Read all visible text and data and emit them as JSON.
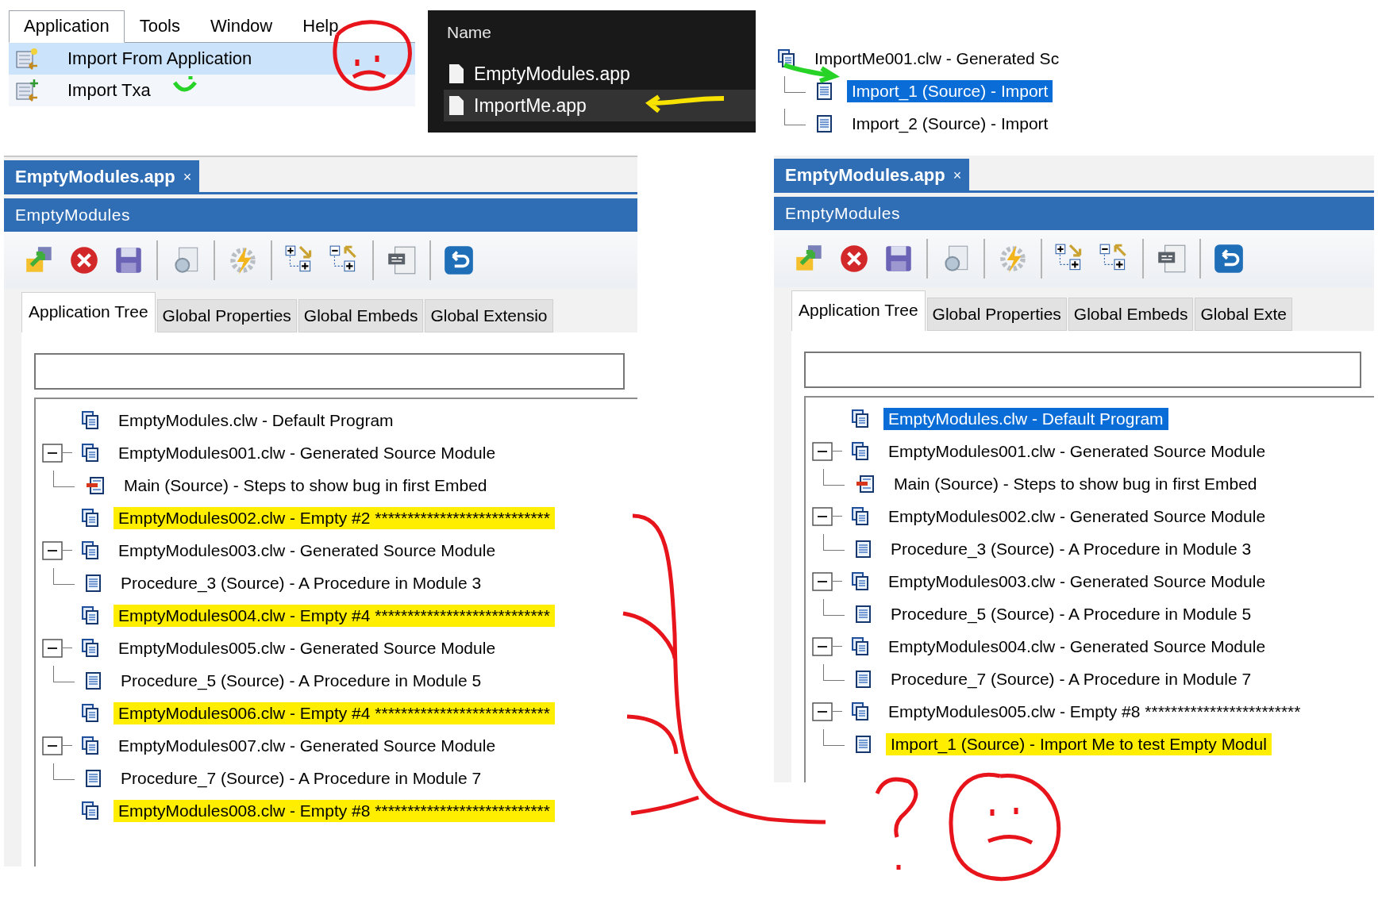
{
  "menu_panel": {
    "menubar": [
      {
        "label": "Application",
        "selected": true
      },
      {
        "label": "Tools",
        "selected": false
      },
      {
        "label": "Window",
        "selected": false
      },
      {
        "label": "Help",
        "selected": false
      }
    ],
    "items": [
      {
        "label": "Import From Application",
        "selected": true
      },
      {
        "label": "Import Txa",
        "selected": false
      }
    ]
  },
  "file_panel": {
    "column_header": "Name",
    "files": [
      {
        "name": "EmptyModules.app",
        "selected": false
      },
      {
        "name": "ImportMe.app",
        "selected": true
      }
    ]
  },
  "import_tree": {
    "rows": [
      {
        "text": "ImportMe001.clw - Generated Sc",
        "kind": "module",
        "selected": false,
        "children": [
          {
            "text": "Import_1 (Source) - Import",
            "kind": "source",
            "selected": true
          },
          {
            "text": "Import_2 (Source) - Import",
            "kind": "source",
            "selected": false
          }
        ]
      }
    ]
  },
  "panels": [
    {
      "doc_tab": "EmptyModules.app",
      "close": "×",
      "title": "EmptyModules",
      "tabs": [
        {
          "label": "Application Tree",
          "selected": true
        },
        {
          "label": "Global Properties",
          "selected": false
        },
        {
          "label": "Global Embeds",
          "selected": false
        },
        {
          "label": "Global Extensio",
          "selected": false
        }
      ],
      "tree": [
        {
          "text": "EmptyModules.clw - Default Program",
          "kind": "module",
          "selected": false,
          "highlighted": false
        },
        {
          "text": "EmptyModules001.clw - Generated Source Module",
          "kind": "module",
          "selected": false,
          "highlighted": false,
          "children": [
            {
              "text": "Main (Source) - Steps to show bug in first Embed",
              "kind": "main",
              "selected": false,
              "highlighted": false
            }
          ]
        },
        {
          "text": "EmptyModules002.clw - Empty #2 ***************************",
          "kind": "module",
          "selected": false,
          "highlighted": true
        },
        {
          "text": "EmptyModules003.clw - Generated Source Module",
          "kind": "module",
          "selected": false,
          "highlighted": false,
          "children": [
            {
              "text": "Procedure_3 (Source) - A Procedure in Module 3",
              "kind": "source",
              "selected": false,
              "highlighted": false
            }
          ]
        },
        {
          "text": "EmptyModules004.clw - Empty #4 ***************************",
          "kind": "module",
          "selected": false,
          "highlighted": true
        },
        {
          "text": "EmptyModules005.clw - Generated Source Module",
          "kind": "module",
          "selected": false,
          "highlighted": false,
          "children": [
            {
              "text": "Procedure_5 (Source) - A Procedure in Module 5",
              "kind": "source",
              "selected": false,
              "highlighted": false
            }
          ]
        },
        {
          "text": "EmptyModules006.clw - Empty #4 ***************************",
          "kind": "module",
          "selected": false,
          "highlighted": true
        },
        {
          "text": "EmptyModules007.clw - Generated Source Module",
          "kind": "module",
          "selected": false,
          "highlighted": false,
          "children": [
            {
              "text": "Procedure_7 (Source) - A Procedure  in Module 7",
              "kind": "source",
              "selected": false,
              "highlighted": false
            }
          ]
        },
        {
          "text": "EmptyModules008.clw - Empty #8 ***************************",
          "kind": "module",
          "selected": false,
          "highlighted": true
        }
      ]
    },
    {
      "doc_tab": "EmptyModules.app",
      "close": "×",
      "title": "EmptyModules",
      "tabs": [
        {
          "label": "Application Tree",
          "selected": true
        },
        {
          "label": "Global Properties",
          "selected": false
        },
        {
          "label": "Global Embeds",
          "selected": false
        },
        {
          "label": "Global Exte",
          "selected": false
        }
      ],
      "tree": [
        {
          "text": "EmptyModules.clw - Default Program",
          "kind": "module",
          "selected": true,
          "highlighted": false
        },
        {
          "text": "EmptyModules001.clw - Generated Source Module",
          "kind": "module",
          "selected": false,
          "highlighted": false,
          "children": [
            {
              "text": "Main (Source) - Steps to show bug in first Embed",
              "kind": "main",
              "selected": false,
              "highlighted": false
            }
          ]
        },
        {
          "text": "EmptyModules002.clw - Generated Source Module",
          "kind": "module",
          "selected": false,
          "highlighted": false,
          "children": [
            {
              "text": "Procedure_3 (Source) - A Procedure in Module 3",
              "kind": "source",
              "selected": false,
              "highlighted": false
            }
          ]
        },
        {
          "text": "EmptyModules003.clw - Generated Source Module",
          "kind": "module",
          "selected": false,
          "highlighted": false,
          "children": [
            {
              "text": "Procedure_5 (Source) - A Procedure in Module 5",
              "kind": "source",
              "selected": false,
              "highlighted": false
            }
          ]
        },
        {
          "text": "EmptyModules004.clw - Generated Source Module",
          "kind": "module",
          "selected": false,
          "highlighted": false,
          "children": [
            {
              "text": "Procedure_7 (Source) - A Procedure  in Module 7",
              "kind": "source",
              "selected": false,
              "highlighted": false
            }
          ]
        },
        {
          "text": "EmptyModules005.clw - Empty #8 ************************",
          "kind": "module",
          "selected": false,
          "highlighted": false,
          "children": [
            {
              "text": "Import_1 (Source) - Import Me to test Empty Modul",
              "kind": "source",
              "selected": false,
              "highlighted": true
            }
          ]
        }
      ]
    }
  ]
}
